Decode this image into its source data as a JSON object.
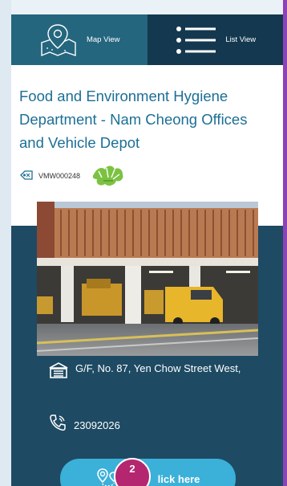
{
  "tabs": [
    {
      "label": "Map View",
      "icon": "map-pin-icon"
    },
    {
      "label": "List View",
      "icon": "list-icon"
    }
  ],
  "facility": {
    "title": "Food and Environment Hygiene Department - Nam Cheong Offices and Vehicle Depot",
    "code": "VMW000248",
    "code_icon": "tag-icon",
    "badge_icon": "bauhinia-icon"
  },
  "photo": {
    "description": "vehicle-depot-photo"
  },
  "address": {
    "icon": "building-icon",
    "text": "G/F, No. 87, Yen Chow Street West,"
  },
  "phone": {
    "icon": "phone-icon",
    "text": "23092026"
  },
  "route_button": {
    "label": "Ro      lick here",
    "icon": "route-icon"
  },
  "overlay": {
    "text": "2"
  },
  "colors": {
    "app_bg": "#1e4a63",
    "tab_active": "#24667e",
    "tab_inactive": "#14384f",
    "title": "#1c6f96",
    "route_button": "#3bb0d8",
    "overlay": "#b4266f"
  }
}
